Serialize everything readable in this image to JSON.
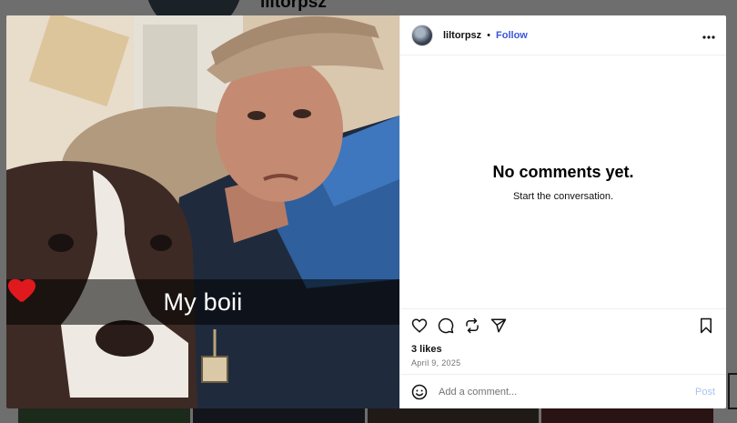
{
  "background": {
    "profile_username": "liltorpsz"
  },
  "post": {
    "caption_text": "My boii",
    "caption_emoji": "heart-icon x2",
    "author": "liltorpsz",
    "separator": "•",
    "follow_label": "Follow",
    "more_label": "•••",
    "empty_title": "No comments yet.",
    "empty_subtitle": "Start the conversation.",
    "likes": "3 likes",
    "date": "April 9, 2025",
    "comment_placeholder": "Add a comment...",
    "post_label": "Post"
  },
  "icons": {
    "like": "heart-outline-icon",
    "comment": "comment-bubble-icon",
    "repost": "repost-icon",
    "share": "share-paper-plane-icon",
    "save": "bookmark-icon",
    "emoji": "emoji-smile-icon",
    "more": "more-horizontal-icon"
  },
  "colors": {
    "follow": "#3b55d9",
    "post_disabled": "#a8c3f0",
    "heart_emoji": "#e0191f"
  }
}
